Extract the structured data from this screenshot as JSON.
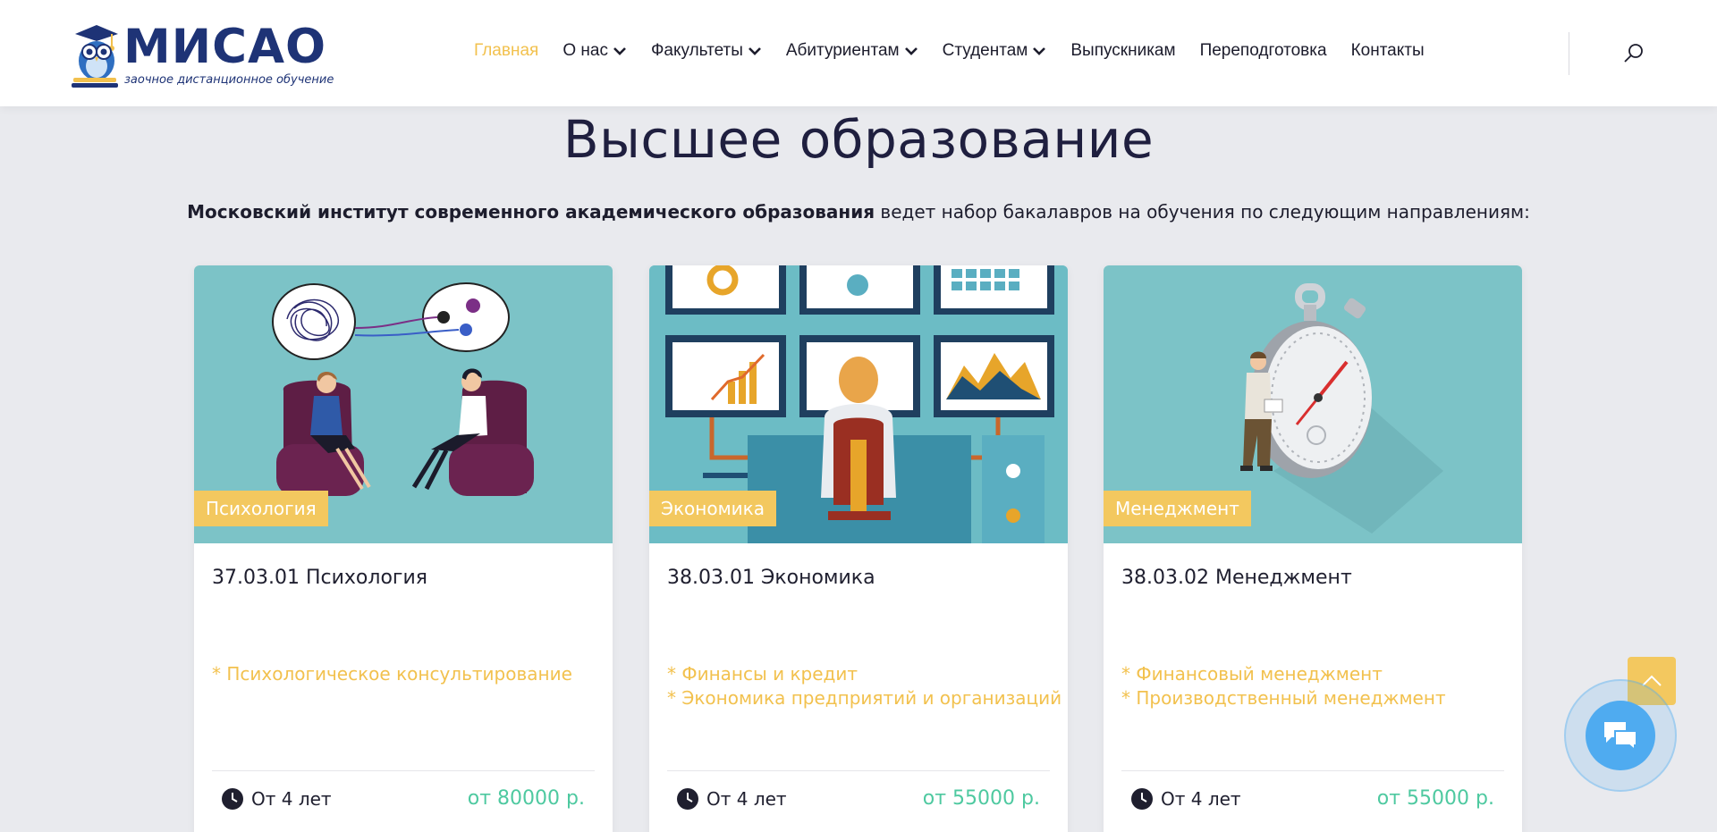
{
  "header": {
    "logo": {
      "text": "МИСАО",
      "subtitle": "заочное дистанционное обучение"
    },
    "nav": [
      {
        "label": "Главная",
        "active": true,
        "dropdown": false
      },
      {
        "label": "О нас",
        "active": false,
        "dropdown": true
      },
      {
        "label": "Факультеты",
        "active": false,
        "dropdown": true
      },
      {
        "label": "Абитуриентам",
        "active": false,
        "dropdown": true
      },
      {
        "label": "Студентам",
        "active": false,
        "dropdown": true
      },
      {
        "label": "Выпускникам",
        "active": false,
        "dropdown": false
      },
      {
        "label": "Переподготовка",
        "active": false,
        "dropdown": false
      },
      {
        "label": "Контакты",
        "active": false,
        "dropdown": false
      }
    ],
    "search_icon": "search-icon"
  },
  "hero": {
    "title": "Высшее образование",
    "subtitle_bold": "Московский институт современного академического образования",
    "subtitle_rest": " ведет набор бакалавров на обучения по следующим направлениям:"
  },
  "cards": [
    {
      "tag": "Психология",
      "title": "37.03.01 Психология",
      "specs": [
        "* Психологическое консультирование"
      ],
      "duration": "От 4 лет",
      "price": "от 80000 р.",
      "illustration": "psychology-session"
    },
    {
      "tag": "Экономика",
      "title": "38.03.01 Экономика",
      "specs": [
        "* Финансы и кредит",
        "* Экономика предприятий и организаций"
      ],
      "duration": "От 4 лет",
      "price": "от 55000 р.",
      "illustration": "monitors-dashboard"
    },
    {
      "tag": "Менеджмент",
      "title": "38.03.02 Менеджмент",
      "specs": [
        "* Финансовый менеджмент",
        "* Производственный менеджмент"
      ],
      "duration": "От 4 лет",
      "price": "от 55000 р.",
      "illustration": "stopwatch-businessman"
    }
  ],
  "floating": {
    "scroll_top_icon": "chevron-up-icon",
    "chat_icon": "chat-bubbles-icon"
  },
  "colors": {
    "accent": "#f2c14e",
    "price": "#4ec9a0",
    "card_image_bg": "#7cc3c7",
    "brand": "#1e3376",
    "chat": "#4fabf0"
  }
}
